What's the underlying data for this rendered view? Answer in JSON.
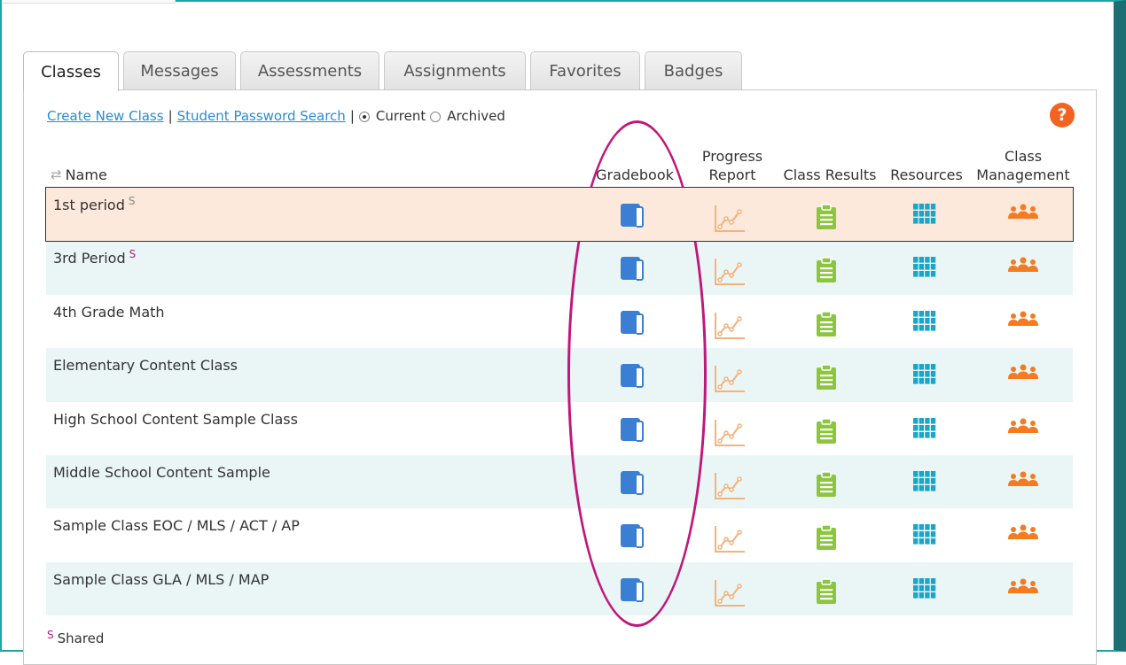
{
  "tabs": [
    {
      "label": "Classes",
      "active": true
    },
    {
      "label": "Messages",
      "active": false
    },
    {
      "label": "Assessments",
      "active": false
    },
    {
      "label": "Assignments",
      "active": false
    },
    {
      "label": "Favorites",
      "active": false
    },
    {
      "label": "Badges",
      "active": false
    }
  ],
  "toolbar": {
    "create_link": "Create New Class",
    "sep": "|",
    "search_link": "Student Password Search",
    "radio_current": "Current",
    "radio_archived": "Archived",
    "help": "?"
  },
  "columns": {
    "name": "Name",
    "gradebook": "Gradebook",
    "progress": "Progress Report",
    "results": "Class Results",
    "resources": "Resources",
    "management": "Class Management"
  },
  "shared_marker": "S",
  "rows": [
    {
      "name": "1st period",
      "shared": true
    },
    {
      "name": "3rd Period",
      "shared": true
    },
    {
      "name": "4th Grade Math",
      "shared": false
    },
    {
      "name": "Elementary Content Class",
      "shared": false
    },
    {
      "name": "High School Content Sample Class",
      "shared": false
    },
    {
      "name": "Middle School Content Sample",
      "shared": false
    },
    {
      "name": "Sample Class EOC / MLS / ACT / AP",
      "shared": false
    },
    {
      "name": "Sample Class GLA / MLS / MAP",
      "shared": false
    }
  ],
  "legend": {
    "marker": "S",
    "label": "Shared"
  },
  "icons": {
    "gradebook": "gradebook-book-icon",
    "progress": "progress-chart-icon",
    "results": "clipboard-icon",
    "resources": "grid-icon",
    "management": "group-people-icon"
  },
  "colors": {
    "accent_link": "#2a8bd1",
    "gradebook": "#3b7fd4",
    "progress": "#f5b27a",
    "results": "#8cc63f",
    "resources": "#1aa6c8",
    "management": "#f47b20",
    "shared": "#b01e7d",
    "highlight_ellipse": "#c0177a"
  }
}
